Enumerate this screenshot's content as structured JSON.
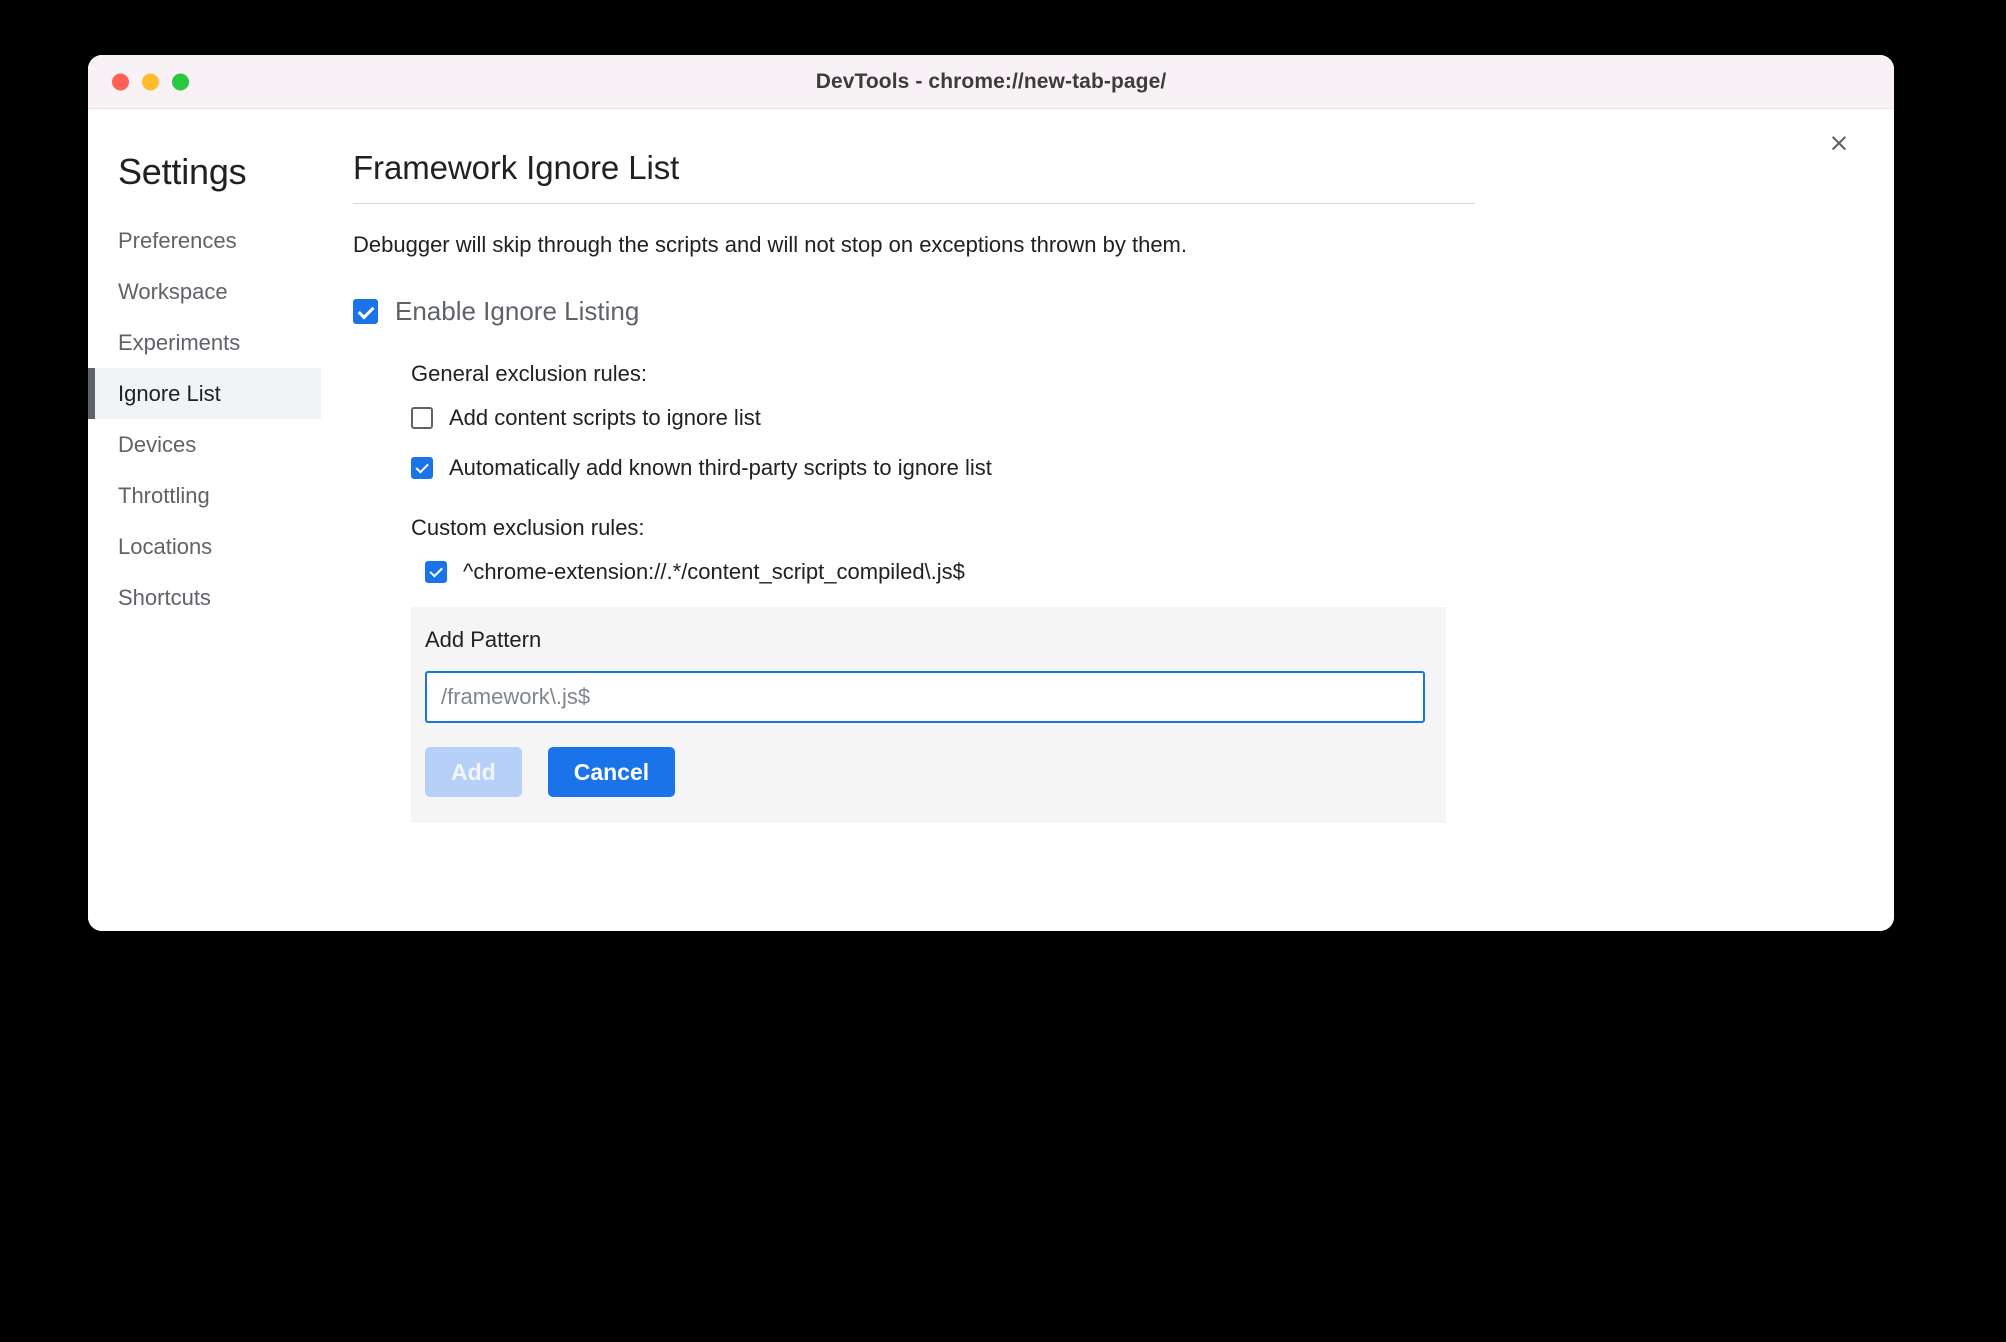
{
  "window": {
    "title": "DevTools - chrome://new-tab-page/",
    "traffic_lights": {
      "close_color": "#ff5f57",
      "minimize_color": "#febc2e",
      "maximize_color": "#28c840"
    }
  },
  "sidebar": {
    "heading": "Settings",
    "items": [
      {
        "label": "Preferences",
        "selected": false
      },
      {
        "label": "Workspace",
        "selected": false
      },
      {
        "label": "Experiments",
        "selected": false
      },
      {
        "label": "Ignore List",
        "selected": true
      },
      {
        "label": "Devices",
        "selected": false
      },
      {
        "label": "Throttling",
        "selected": false
      },
      {
        "label": "Locations",
        "selected": false
      },
      {
        "label": "Shortcuts",
        "selected": false
      }
    ]
  },
  "main": {
    "close_icon": "×",
    "title": "Framework Ignore List",
    "description": "Debugger will skip through the scripts and will not stop on exceptions thrown by them.",
    "enable_ignore_listing": {
      "label": "Enable Ignore Listing",
      "checked": true
    },
    "general_section": {
      "label": "General exclusion rules:",
      "rules": [
        {
          "label": "Add content scripts to ignore list",
          "checked": false
        },
        {
          "label": "Automatically add known third-party scripts to ignore list",
          "checked": true
        }
      ]
    },
    "custom_section": {
      "label": "Custom exclusion rules:",
      "rules": [
        {
          "pattern": "^chrome-extension://.*/content_script_compiled\\.js$",
          "checked": true
        }
      ]
    },
    "add_pattern": {
      "title": "Add Pattern",
      "input_value": "",
      "input_placeholder": "/framework\\.js$",
      "add_label": "Add",
      "add_disabled": true,
      "cancel_label": "Cancel"
    }
  },
  "colors": {
    "accent_blue": "#1a73e8",
    "disabled_blue": "#b6d0f7",
    "selected_bg": "#f1f3f4",
    "panel_bg": "#f5f5f5",
    "titlebar_bg": "#f8f2f6"
  }
}
